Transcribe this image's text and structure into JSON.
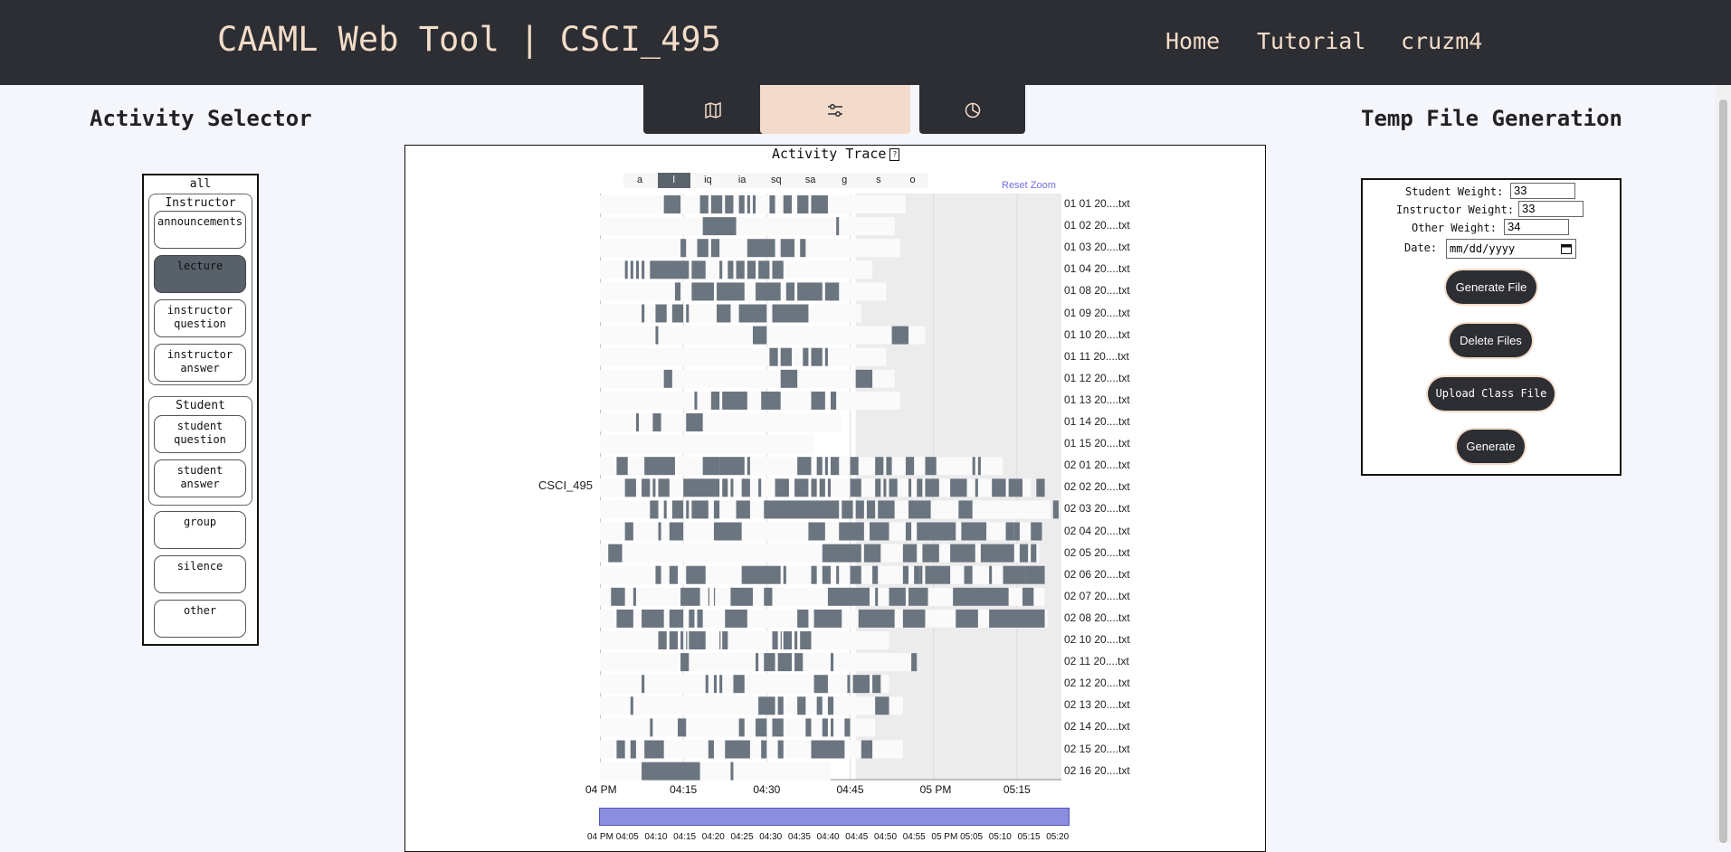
{
  "header": {
    "brand": "CAAML Web Tool | CSCI_495",
    "nav": [
      "Home",
      "Tutorial",
      "cruzm4"
    ]
  },
  "tabs": [
    {
      "icon": "map-icon",
      "active": false
    },
    {
      "icon": "sliders-icon",
      "active": true
    },
    {
      "icon": "pie-chart-icon",
      "active": false
    }
  ],
  "activity_selector": {
    "title": "Activity Selector",
    "all_label": "all",
    "instructor_group": "Instructor",
    "instructor_items": [
      "announcements",
      "lecture",
      "instructor question",
      "instructor answer"
    ],
    "student_group": "Student",
    "student_items": [
      "student question",
      "student answer"
    ],
    "other_items": [
      "group",
      "silence",
      "other"
    ],
    "active_item": "lecture"
  },
  "temp_file": {
    "title": "Temp File Generation",
    "student_weight_label": "Student Weight:",
    "student_weight": "33",
    "instructor_weight_label": "Instructor Weight:",
    "instructor_weight": "33",
    "other_weight_label": "Other Weight:",
    "other_weight": "34",
    "date_label": "Date:",
    "date_placeholder": "mm/dd/yyyy",
    "buttons": [
      "Generate File",
      "Delete Files",
      "Upload Class File",
      "Generate"
    ]
  },
  "chart_data": {
    "type": "timeline",
    "title": "Activity Trace",
    "help_icon": "?",
    "reset_zoom": "Reset Zoom",
    "course": "CSCI_495",
    "filters": [
      "a",
      "l",
      "iq",
      "ia",
      "sq",
      "sa",
      "g",
      "s",
      "o"
    ],
    "active_filter": "l",
    "x_ticks": [
      "04 PM",
      "04:15",
      "04:30",
      "04:45",
      "05 PM",
      "05:15"
    ],
    "brush_ticks": [
      "04 PM",
      "04:05",
      "04:10",
      "04:15",
      "04:20",
      "04:25",
      "04:30",
      "04:35",
      "04:40",
      "04:45",
      "04:50",
      "04:55",
      "05 PM",
      "05:05",
      "05:10",
      "05:15",
      "05:20"
    ],
    "x_domain_minutes": [
      0,
      83
    ],
    "rows": [
      {
        "label": "01 01 20....txt",
        "end": 55,
        "segs": [
          [
            11.5,
            14.5
          ],
          [
            18,
            19.5
          ],
          [
            20,
            22
          ],
          [
            22.5,
            24
          ],
          [
            25,
            26
          ],
          [
            26.5,
            27
          ],
          [
            27.5,
            28
          ],
          [
            30.5,
            31.5
          ],
          [
            33,
            34.5
          ],
          [
            35.5,
            37.5
          ],
          [
            38,
            41
          ]
        ]
      },
      {
        "label": "01 02 20....txt",
        "end": 53,
        "segs": [
          [
            18.5,
            24.5
          ],
          [
            42.5,
            43
          ]
        ]
      },
      {
        "label": "01 03 20....txt",
        "end": 54,
        "segs": [
          [
            14.5,
            15.5
          ],
          [
            17.5,
            19.5
          ],
          [
            20,
            21.5
          ],
          [
            26.5,
            31.5
          ],
          [
            32.5,
            35
          ],
          [
            36,
            37
          ]
        ]
      },
      {
        "label": "01 04 20....txt",
        "end": 49,
        "segs": [
          [
            4.5,
            5
          ],
          [
            5.5,
            6
          ],
          [
            6.5,
            7
          ],
          [
            7.5,
            8
          ],
          [
            9,
            16
          ],
          [
            16.5,
            19
          ],
          [
            21.5,
            22
          ],
          [
            23,
            24
          ],
          [
            24.5,
            26
          ],
          [
            26.5,
            28
          ],
          [
            28.5,
            30.5
          ],
          [
            31,
            33
          ]
        ]
      },
      {
        "label": "01 08 20....txt",
        "end": 51.5,
        "segs": [
          [
            13.5,
            14.5
          ],
          [
            16.5,
            20.5
          ],
          [
            21,
            26
          ],
          [
            28,
            32.5
          ],
          [
            33.5,
            35
          ],
          [
            35.5,
            40
          ],
          [
            40.5,
            43
          ]
        ]
      },
      {
        "label": "01 09 20....txt",
        "end": 47,
        "segs": [
          [
            7.5,
            8
          ],
          [
            10,
            12
          ],
          [
            13,
            15
          ],
          [
            15.5,
            16
          ],
          [
            21,
            23.5
          ],
          [
            25,
            30
          ],
          [
            31,
            37.5
          ]
        ]
      },
      {
        "label": "01 10 20....txt",
        "end": 58.5,
        "segs": [
          [
            10,
            10.5
          ],
          [
            27.5,
            30
          ],
          [
            52.5,
            55.5
          ]
        ]
      },
      {
        "label": "01 11 20....txt",
        "end": 51.5,
        "segs": [
          [
            30.5,
            32
          ],
          [
            32.5,
            34.5
          ],
          [
            36.5,
            37.5
          ],
          [
            38,
            40
          ],
          [
            40.5,
            41
          ]
        ]
      },
      {
        "label": "01 12 20....txt",
        "end": 53,
        "segs": [
          [
            11.5,
            13
          ],
          [
            32.5,
            35.5
          ],
          [
            46,
            49
          ]
        ]
      },
      {
        "label": "01 13 20....txt",
        "end": 54,
        "segs": [
          [
            17,
            17.5
          ],
          [
            20,
            21.5
          ],
          [
            22,
            26.5
          ],
          [
            29,
            32.5
          ],
          [
            38,
            40.5
          ],
          [
            41.5,
            42.5
          ]
        ]
      },
      {
        "label": "01 14 20....txt",
        "end": 43.5,
        "segs": [
          [
            6.5,
            7
          ],
          [
            9.5,
            11
          ],
          [
            15.5,
            18.5
          ]
        ]
      },
      {
        "label": "01 15 20....txt",
        "end": 38.5,
        "segs": []
      },
      {
        "label": "02 01 20....txt",
        "end": 72.5,
        "segs": [
          [
            3,
            5
          ],
          [
            8,
            13.5
          ],
          [
            18.5,
            21.5
          ],
          [
            21.5,
            26
          ],
          [
            26.5,
            27
          ],
          [
            35.5,
            38
          ],
          [
            39,
            40
          ],
          [
            40.5,
            41
          ],
          [
            41.5,
            43
          ],
          [
            45,
            46.5
          ],
          [
            49.5,
            51
          ],
          [
            51.5,
            52.5
          ],
          [
            55,
            56.5
          ],
          [
            58.5,
            60.5
          ],
          [
            67,
            67.5
          ],
          [
            68,
            68.5
          ]
        ]
      },
      {
        "label": "02 02 20....txt",
        "end": 77.5,
        "segs": [
          [
            4.5,
            6.5
          ],
          [
            7.5,
            9
          ],
          [
            9.5,
            10
          ],
          [
            10.5,
            12.5
          ],
          [
            15,
            21.5
          ],
          [
            22,
            23
          ],
          [
            23.5,
            24
          ],
          [
            25.5,
            27
          ],
          [
            28.5,
            29
          ],
          [
            31.5,
            34
          ],
          [
            35,
            37.5
          ],
          [
            38,
            39
          ],
          [
            39.5,
            40.5
          ],
          [
            41,
            41.5
          ],
          [
            45,
            47
          ],
          [
            49.5,
            50.5
          ],
          [
            51,
            51.5
          ],
          [
            52,
            53.5
          ],
          [
            55.5,
            56
          ],
          [
            57,
            58
          ],
          [
            58.5,
            61
          ],
          [
            63,
            66
          ],
          [
            67.5,
            68
          ],
          [
            70.5,
            73
          ],
          [
            73.5,
            76
          ],
          [
            78.5,
            80
          ]
        ]
      },
      {
        "label": "02 03 20....txt",
        "end": 81,
        "segs": [
          [
            9,
            10.5
          ],
          [
            11.5,
            12
          ],
          [
            13,
            15
          ],
          [
            15.5,
            16
          ],
          [
            16.5,
            19.5
          ],
          [
            20.5,
            21.5
          ],
          [
            24.5,
            27
          ],
          [
            29.5,
            43
          ],
          [
            43.5,
            45.5
          ],
          [
            46,
            47.5
          ],
          [
            48,
            49.5
          ],
          [
            50,
            53
          ],
          [
            55.5,
            59.5
          ],
          [
            64.5,
            67
          ],
          [
            81.5,
            82.5
          ]
        ]
      },
      {
        "label": "02 04 20....txt",
        "end": 79.5,
        "segs": [
          [
            4.5,
            6
          ],
          [
            10.5,
            11
          ],
          [
            12.5,
            15
          ],
          [
            20.5,
            25.5
          ],
          [
            37.5,
            40.5
          ],
          [
            43,
            47.5
          ],
          [
            48.5,
            51.5
          ],
          [
            51.5,
            52
          ],
          [
            55,
            56
          ],
          [
            57,
            64
          ],
          [
            65,
            69.5
          ],
          [
            73,
            74.5
          ],
          [
            74.5,
            75.5
          ],
          [
            77.5,
            79.5
          ]
        ]
      },
      {
        "label": "02 05 20....txt",
        "end": 79,
        "segs": [
          [
            1.5,
            4
          ],
          [
            40,
            47
          ],
          [
            47.5,
            50.5
          ],
          [
            54.5,
            57
          ],
          [
            58,
            61
          ],
          [
            63,
            67.5
          ],
          [
            68.5,
            74.5
          ],
          [
            75.5,
            77
          ],
          [
            77.5,
            78.5
          ]
        ]
      },
      {
        "label": "02 06 20....txt",
        "end": 79.5,
        "segs": [
          [
            10,
            11
          ],
          [
            12.5,
            14
          ],
          [
            15.5,
            19
          ],
          [
            25.5,
            32.5
          ],
          [
            33,
            33.5
          ],
          [
            38,
            39
          ],
          [
            40,
            41.5
          ],
          [
            42.5,
            43
          ],
          [
            45,
            47
          ],
          [
            49,
            50
          ],
          [
            54.5,
            55.5
          ],
          [
            56.5,
            57.5
          ],
          [
            57.5,
            58
          ],
          [
            58.5,
            63
          ],
          [
            65.5,
            67
          ],
          [
            70,
            70.5
          ],
          [
            72.5,
            76.5
          ],
          [
            76.5,
            80
          ]
        ]
      },
      {
        "label": "02 07 20....txt",
        "end": 80,
        "segs": [
          [
            2,
            4.5
          ],
          [
            6,
            6.5
          ],
          [
            14.5,
            18
          ],
          [
            19.5,
            19.5
          ],
          [
            20.5,
            20.5
          ],
          [
            23.5,
            27.5
          ],
          [
            29.5,
            31
          ],
          [
            41,
            48.5
          ],
          [
            49.5,
            50
          ],
          [
            52,
            55
          ],
          [
            55.5,
            59
          ],
          [
            63.5,
            73.5
          ],
          [
            76,
            78
          ]
        ]
      },
      {
        "label": "02 08 20....txt",
        "end": 80.5,
        "segs": [
          [
            3,
            6
          ],
          [
            7.5,
            11.5
          ],
          [
            12.5,
            15
          ],
          [
            16,
            17
          ],
          [
            17.5,
            18.5
          ],
          [
            22.5,
            26.5
          ],
          [
            35.5,
            37.5
          ],
          [
            38.5,
            43.5
          ],
          [
            46.5,
            53
          ],
          [
            54.5,
            58.5
          ],
          [
            64,
            68
          ],
          [
            70,
            80
          ]
        ]
      },
      {
        "label": "02 10 20....txt",
        "end": 52,
        "segs": [
          [
            10.5,
            12
          ],
          [
            12.5,
            14
          ],
          [
            14.5,
            15
          ],
          [
            15.5,
            15.5
          ],
          [
            16,
            17.5
          ],
          [
            17.5,
            19
          ],
          [
            21.5,
            21.5
          ],
          [
            22,
            23
          ],
          [
            31,
            32
          ],
          [
            32.5,
            32.5
          ],
          [
            33,
            34.5
          ],
          [
            35,
            35.5
          ],
          [
            36,
            38
          ]
        ]
      },
      {
        "label": "02 11 20....txt",
        "end": 57,
        "segs": [
          [
            14.5,
            16
          ],
          [
            28,
            28.5
          ],
          [
            29.5,
            31.5
          ],
          [
            32,
            34.5
          ],
          [
            35,
            36.5
          ],
          [
            41.5,
            42
          ],
          [
            56,
            57
          ]
        ]
      },
      {
        "label": "02 12 20....txt",
        "end": 52,
        "segs": [
          [
            7.5,
            8
          ],
          [
            19,
            19.5
          ],
          [
            20.5,
            21
          ],
          [
            21.5,
            22
          ],
          [
            24,
            26
          ],
          [
            38.5,
            41
          ],
          [
            44.5,
            45
          ],
          [
            45.5,
            48.5
          ],
          [
            49,
            50.5
          ]
        ]
      },
      {
        "label": "02 13 20....txt",
        "end": 54.5,
        "segs": [
          [
            5.5,
            6
          ],
          [
            28.5,
            31.5
          ],
          [
            32,
            33
          ],
          [
            35.5,
            37
          ],
          [
            39,
            40
          ],
          [
            41,
            42
          ],
          [
            49.5,
            52
          ]
        ]
      },
      {
        "label": "02 14 20....txt",
        "end": 49.5,
        "segs": [
          [
            9,
            9.5
          ],
          [
            14,
            15.5
          ],
          [
            25,
            26
          ],
          [
            28,
            30
          ],
          [
            31,
            33
          ],
          [
            37,
            38
          ],
          [
            40,
            41
          ],
          [
            41.5,
            42
          ],
          [
            44,
            45
          ]
        ]
      },
      {
        "label": "02 15 20....txt",
        "end": 54.5,
        "segs": [
          [
            3,
            4.5
          ],
          [
            5.5,
            6.5
          ],
          [
            8,
            11.5
          ],
          [
            19.5,
            20.5
          ],
          [
            22.5,
            27
          ],
          [
            29,
            30
          ],
          [
            32,
            33
          ],
          [
            38,
            44
          ],
          [
            47,
            49
          ]
        ]
      },
      {
        "label": "02 16 20....txt",
        "end": 41.5,
        "segs": [
          [
            7.5,
            18
          ],
          [
            23.5,
            24
          ]
        ]
      }
    ]
  }
}
